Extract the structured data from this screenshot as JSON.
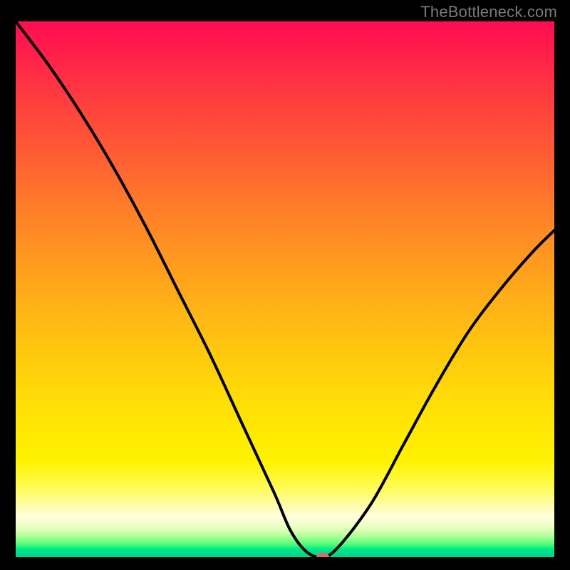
{
  "watermark": "TheBottleneck.com",
  "colors": {
    "frame": "#000000",
    "curve": "#000000",
    "marker": "#d76a6e",
    "gradient_top": "#ff0d52",
    "gradient_mid": "#ffe404",
    "gradient_bottom": "#00d28d"
  },
  "chart_data": {
    "type": "line",
    "title": "",
    "xlabel": "",
    "ylabel": "",
    "xlim": [
      0,
      100
    ],
    "ylim": [
      0,
      100
    ],
    "grid": false,
    "legend": false,
    "series": [
      {
        "name": "bottleneck-curve",
        "x": [
          0,
          6,
          12,
          18,
          24,
          30,
          36,
          42,
          48,
          51,
          54,
          57,
          60,
          66,
          72,
          78,
          84,
          90,
          96,
          100
        ],
        "y": [
          100,
          92,
          83,
          73,
          62,
          50,
          38,
          25,
          12,
          5,
          1,
          0,
          2,
          10,
          21,
          32,
          42,
          50,
          57,
          61
        ]
      }
    ],
    "marker": {
      "x": 57,
      "y": 0
    },
    "background_scale": {
      "description": "vertical color gradient mapping y-value to severity",
      "stops": [
        {
          "pct": 0,
          "color": "#ff0d52"
        },
        {
          "pct": 50,
          "color": "#ff9820"
        },
        {
          "pct": 82,
          "color": "#fff300"
        },
        {
          "pct": 94,
          "color": "#e8ffc0"
        },
        {
          "pct": 100,
          "color": "#00d28d"
        }
      ]
    }
  }
}
